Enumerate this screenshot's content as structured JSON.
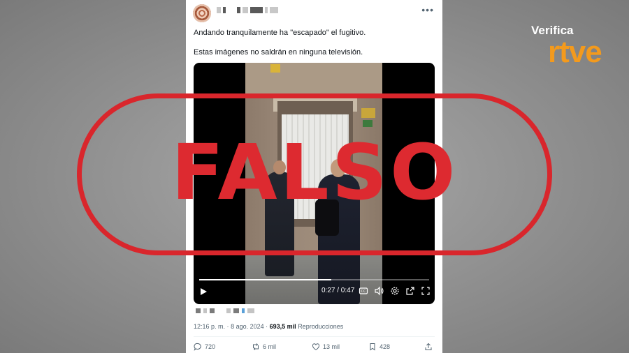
{
  "tweet": {
    "text_line_1": "Andando tranquilamente ha \"escapado\" el fugitivo.",
    "text_line_2": "Estas imágenes no saldrán en ninguna televisión.",
    "more_icon": "more-icon",
    "video": {
      "time_readout": "0:27 / 0:47",
      "progress_fraction": 0.574
    },
    "meta": {
      "time": "12:16 p. m.",
      "separator": "·",
      "date": "8 ago. 2024",
      "views": "693,5 mil",
      "views_label": "Reproducciones"
    },
    "actions": {
      "replies": "720",
      "reposts": "6 mil",
      "likes": "13 mil",
      "bookmarks": "428"
    }
  },
  "stamp": {
    "text": "FALSO",
    "color": "#d9262c"
  },
  "watermark": {
    "verifica": "Verifica",
    "brand": "rtve",
    "brand_color": "#f39a1d"
  }
}
